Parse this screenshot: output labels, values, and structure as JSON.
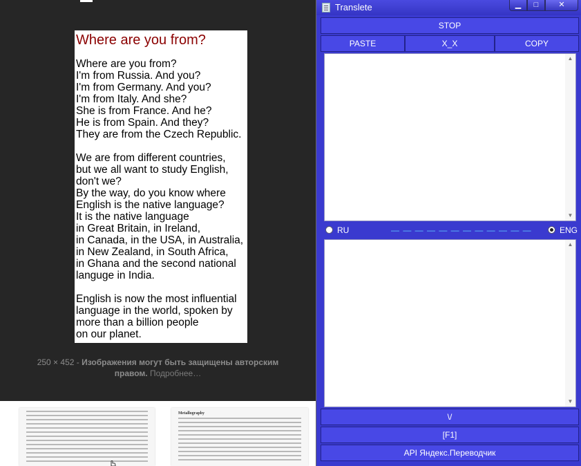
{
  "viewer": {
    "doc_title": "Where are you from?",
    "doc_lines": [
      "Where are you from?",
      "I'm from Russia. And you?",
      "I'm from Germany. And you?",
      "I'm from Italy. And she?",
      "She is from France. And he?",
      "He is from Spain. And they?",
      "They are from the Czech Republic.",
      "",
      "We are from different countries,",
      "but we all want to study English,",
      "don't we?",
      "By the way, do you know where",
      "English is the native language?",
      "It is the native language",
      "in Great Britain, in Ireland,",
      "in Canada, in the USA, in Australia,",
      "in New Zealand, in South Africa,",
      "in Ghana and the second national",
      "languge in India.",
      "",
      "English is now the most influential",
      "language in the world, spoken by",
      "more than a billion people",
      "on our planet."
    ],
    "dimensions": "250 × 452",
    "separator": "-",
    "copyright_line1": "Изображения могут быть защищены авторским",
    "copyright_line2": "правом.",
    "more_link": "Подробнее…",
    "thumb2_title": "Metallography"
  },
  "app": {
    "title": "Translete",
    "win_min": "▁",
    "win_max": "□",
    "win_close": "✕",
    "stop_label": "STOP",
    "paste_label": "PASTE",
    "xx_label": "X_X",
    "copy_label": "COPY",
    "lang_from": "RU",
    "lang_to": "ENG",
    "lang_from_selected": false,
    "lang_to_selected": true,
    "progress_dashes": "— — — — — — — — — — — —",
    "source_text": "",
    "result_text": "",
    "down_label": "\\/",
    "f1_label": "[F1]",
    "api_label": "API Яндекс.Переводчик",
    "accent_color": "#4848e6",
    "dash_color": "#5ec8ff"
  }
}
